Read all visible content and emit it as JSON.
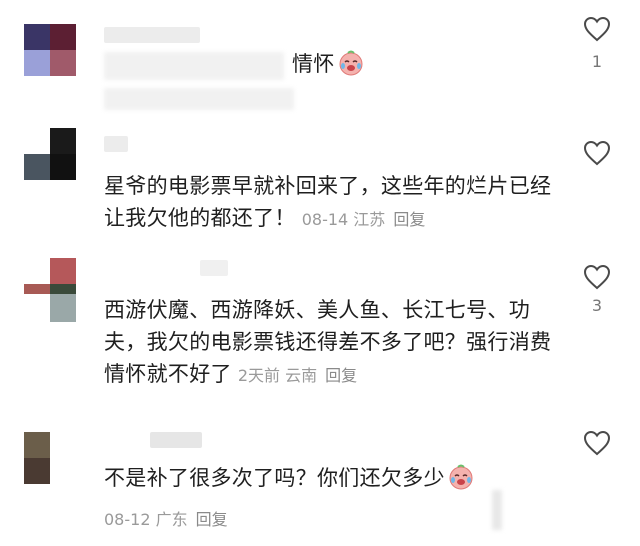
{
  "comments": [
    {
      "text": "情怀",
      "likes": "1",
      "emoji": "crying-laughing-emoji"
    },
    {
      "text": "星爷的电影票早就补回来了，这些年的烂片已经让我欠他的都还了！",
      "date": "08-14",
      "location": "江苏",
      "reply_label": "回复"
    },
    {
      "text": "西游伏魔、西游降妖、美人鱼、长江七号、功夫，我欠的电影票钱还得差不多了吧？强行消费情怀就不好了",
      "date": "2天前",
      "location": "云南",
      "reply_label": "回复",
      "likes": "3"
    },
    {
      "text": "不是补了很多次了吗？你们还欠多少",
      "date": "08-12",
      "location": "广东",
      "reply_label": "回复",
      "emoji": "crying-laughing-emoji"
    }
  ],
  "colors": {
    "text": "#1f1f1f",
    "meta": "#9a9a9a",
    "heart_outline": "#4a4a4a"
  }
}
